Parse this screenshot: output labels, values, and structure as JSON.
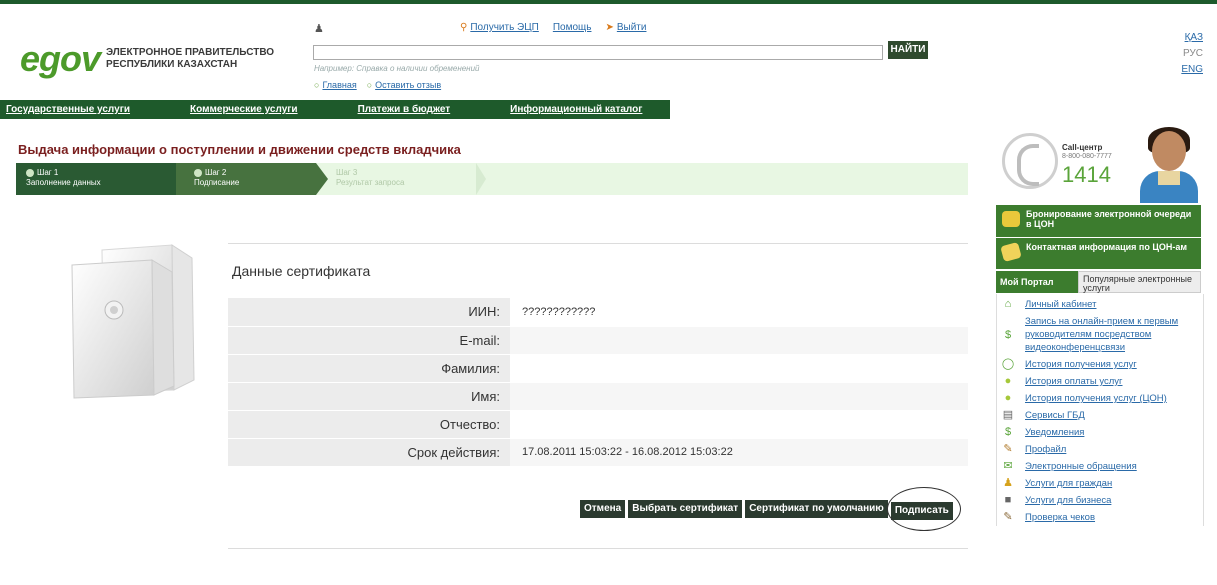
{
  "header": {
    "logo_mark": "egov",
    "logo_line1": "ЭЛЕКТРОННОЕ ПРАВИТЕЛЬСТВО",
    "logo_line2": "РЕСПУБЛИКИ КАЗАХСТАН",
    "top_links": [
      {
        "icon": "key-icon",
        "label": "Получить ЭЦП"
      },
      {
        "icon": "",
        "label": "Помощь"
      },
      {
        "icon": "exit-icon",
        "label": "Выйти"
      }
    ],
    "search_placeholder": "",
    "search_button": "НАЙТИ",
    "search_hint": "Например: Справка о наличии обременений",
    "sub_links": [
      "Главная",
      "Оставить отзыв"
    ],
    "languages": [
      {
        "label": "ҚАЗ",
        "active": false
      },
      {
        "label": "РУС",
        "active": true
      },
      {
        "label": "ENG",
        "active": false
      }
    ]
  },
  "nav": [
    "Государственные услуги",
    "Коммерческие услуги",
    "Платежи в бюджет",
    "Информационный каталог"
  ],
  "page_title": "Выдача информации о поступлении и движении средств вкладчика",
  "steps": [
    {
      "num": "Шаг 1",
      "label": "Заполнение данных"
    },
    {
      "num": "Шаг 2",
      "label": "Подписание"
    },
    {
      "num": "Шаг 3",
      "label": "Результат запроса"
    }
  ],
  "certificate": {
    "title": "Данные сертификата",
    "rows": [
      {
        "label": "ИИН:",
        "value": "????????????"
      },
      {
        "label": "E-mail:",
        "value": ""
      },
      {
        "label": "Фамилия:",
        "value": ""
      },
      {
        "label": "Имя:",
        "value": ""
      },
      {
        "label": "Отчество:",
        "value": ""
      },
      {
        "label": "Срок действия:",
        "value": "17.08.2011 15:03:22 - 16.08.2012 15:03:22"
      }
    ]
  },
  "buttons": {
    "cancel": "Отмена",
    "choose": "Выбрать сертификат",
    "default_cert": "Сертификат по умолчанию",
    "sign": "Подписать"
  },
  "sidebar": {
    "call_label": "Call-центр",
    "call_phone": "8-800-080-7777",
    "call_number": "1414",
    "block1": "Бронирование электронной очереди в ЦОН",
    "block2": "Контактная информация по ЦОН-ам",
    "tab_active": "Мой Портал",
    "tab_inactive": "Популярные электронные услуги",
    "items": [
      {
        "icon": "home-icon",
        "label": "Личный кабинет"
      },
      {
        "icon": "video-icon",
        "label": "Запись на онлайн-прием к первым руководителям посредством видеоконференцсвязи"
      },
      {
        "icon": "history-icon",
        "label": "История получения услуг"
      },
      {
        "icon": "payment-icon",
        "label": "История оплаты услуг"
      },
      {
        "icon": "history-con-icon",
        "label": "История получения услуг (ЦОН)"
      },
      {
        "icon": "database-icon",
        "label": "Сервисы ГБД"
      },
      {
        "icon": "notification-icon",
        "label": "Уведомления"
      },
      {
        "icon": "profile-icon",
        "label": "Профайл"
      },
      {
        "icon": "mail-icon",
        "label": "Электронные обращения"
      },
      {
        "icon": "citizen-icon",
        "label": "Услуги для граждан"
      },
      {
        "icon": "business-icon",
        "label": "Услуги для бизнеса"
      },
      {
        "icon": "receipt-icon",
        "label": "Проверка чеков"
      }
    ]
  }
}
